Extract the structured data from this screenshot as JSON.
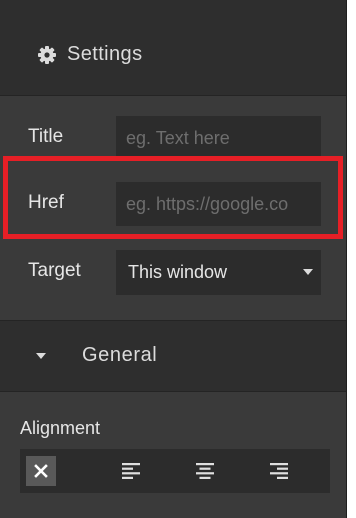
{
  "settings": {
    "title": "Settings",
    "icon": "gear-icon"
  },
  "fields": {
    "title": {
      "label": "Title",
      "placeholder": "eg. Text here"
    },
    "href": {
      "label": "Href",
      "placeholder": "eg. https://google.co"
    },
    "target": {
      "label": "Target",
      "value": "This window"
    }
  },
  "general": {
    "title": "General"
  },
  "alignment": {
    "label": "Alignment",
    "options": [
      {
        "name": "none",
        "icon": "close-icon",
        "active": true
      },
      {
        "name": "left",
        "icon": "align-left-icon",
        "active": false
      },
      {
        "name": "center",
        "icon": "align-center-icon",
        "active": false
      },
      {
        "name": "right",
        "icon": "align-right-icon",
        "active": false
      }
    ]
  },
  "colors": {
    "panel": "#3a3a3a",
    "header": "#2e2e2e",
    "input": "#2c2c2c",
    "highlight": "#e61f26"
  }
}
